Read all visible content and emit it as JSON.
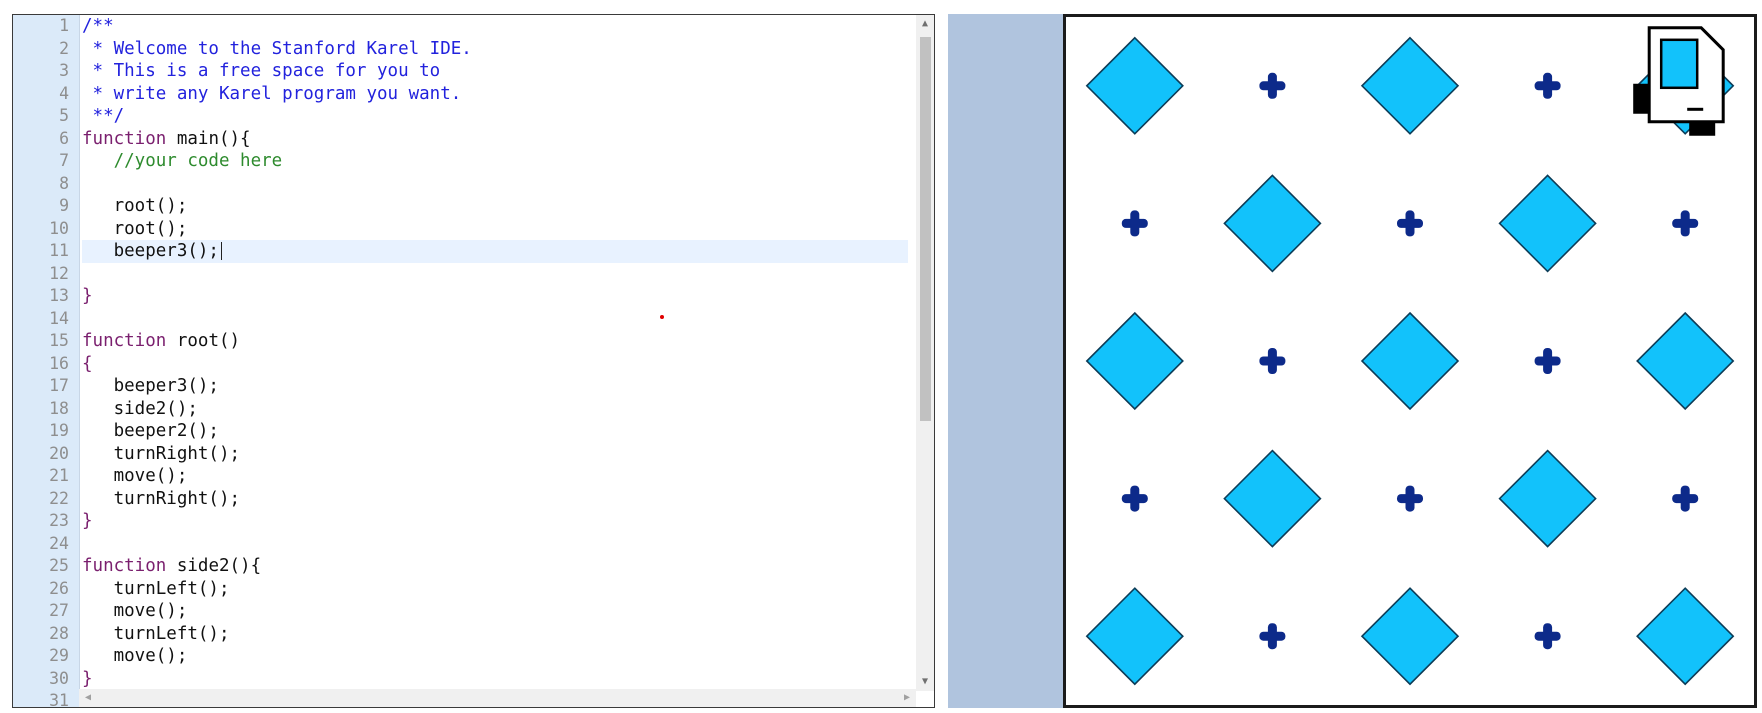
{
  "editor": {
    "lines": [
      {
        "n": "1",
        "t": "/**",
        "cls": "cm"
      },
      {
        "n": "2",
        "t": " * Welcome to the Stanford Karel IDE.",
        "cls": "cm"
      },
      {
        "n": "3",
        "t": " * This is a free space for you to",
        "cls": "cm"
      },
      {
        "n": "4",
        "t": " * write any Karel program you want.",
        "cls": "cm"
      },
      {
        "n": "5",
        "t": " **/",
        "cls": "cm"
      },
      {
        "n": "6",
        "kw": "function",
        "t": " main(){"
      },
      {
        "n": "7",
        "t": "   //your code here",
        "cls": "lc"
      },
      {
        "n": "8",
        "t": ""
      },
      {
        "n": "9",
        "t": "   root();"
      },
      {
        "n": "10",
        "t": "   root();"
      },
      {
        "n": "11",
        "t": "   beeper3();",
        "active": true
      },
      {
        "n": "12",
        "t": ""
      },
      {
        "n": "13",
        "t": "}",
        "cls": "k"
      },
      {
        "n": "14",
        "t": ""
      },
      {
        "n": "15",
        "kw": "function",
        "t": " root()"
      },
      {
        "n": "16",
        "t": "{",
        "cls": "k"
      },
      {
        "n": "17",
        "t": "   beeper3();"
      },
      {
        "n": "18",
        "t": "   side2();"
      },
      {
        "n": "19",
        "t": "   beeper2();"
      },
      {
        "n": "20",
        "t": "   turnRight();"
      },
      {
        "n": "21",
        "t": "   move();"
      },
      {
        "n": "22",
        "t": "   turnRight();"
      },
      {
        "n": "23",
        "t": "}",
        "cls": "k"
      },
      {
        "n": "24",
        "t": ""
      },
      {
        "n": "25",
        "kw": "function",
        "t": " side2(){"
      },
      {
        "n": "26",
        "t": "   turnLeft();"
      },
      {
        "n": "27",
        "t": "   move();"
      },
      {
        "n": "28",
        "t": "   turnLeft();"
      },
      {
        "n": "29",
        "t": "   move();"
      },
      {
        "n": "30",
        "t": "}",
        "cls": "k"
      },
      {
        "n": "31",
        "t": ""
      }
    ]
  },
  "world": {
    "rows": 5,
    "cols": 5,
    "grid": [
      [
        "beeper",
        "corner",
        "beeper",
        "corner",
        "karel"
      ],
      [
        "corner",
        "beeper",
        "corner",
        "beeper",
        "corner"
      ],
      [
        "beeper",
        "corner",
        "beeper",
        "corner",
        "beeper"
      ],
      [
        "corner",
        "beeper",
        "corner",
        "beeper",
        "corner"
      ],
      [
        "beeper",
        "corner",
        "beeper",
        "corner",
        "beeper"
      ]
    ],
    "colors": {
      "beeper_fill": "#12c2fb",
      "beeper_stroke": "#0c3c57",
      "corner": "#0d2a8a",
      "border": "#1b1b1b",
      "side_panel": "#b0c4de"
    }
  }
}
